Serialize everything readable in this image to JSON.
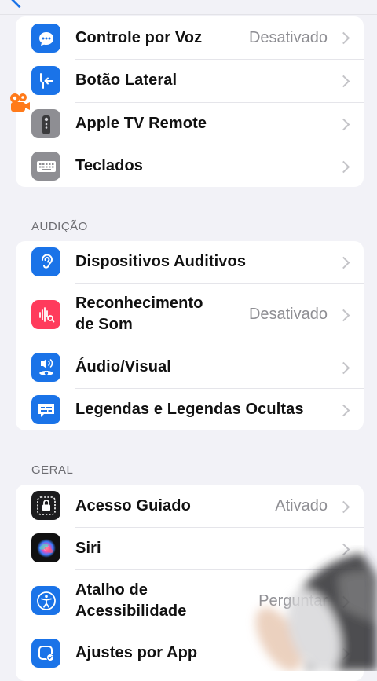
{
  "vision_group": [
    {
      "label": "Controle por Voz",
      "value": "Desativado",
      "icon": "voice-control-icon",
      "color": "#1a73e8"
    },
    {
      "label": "Botão Lateral",
      "value": "",
      "icon": "side-button-icon",
      "color": "#1a73e8"
    },
    {
      "label": "Apple TV Remote",
      "value": "",
      "icon": "tv-remote-icon",
      "color": "#8e8e93"
    },
    {
      "label": "Teclados",
      "value": "",
      "icon": "keyboard-icon",
      "color": "#8e8e93"
    }
  ],
  "hearing": {
    "header": "AUDIÇÃO",
    "items": [
      {
        "label": "Dispositivos Auditivos",
        "value": "",
        "icon": "ear-icon",
        "color": "#1a73e8"
      },
      {
        "label_line1": "Reconhecimento",
        "label_line2": "de Som",
        "value": "Desativado",
        "icon": "sound-recognition-icon",
        "color": "#ff3b5c"
      },
      {
        "label": "Áudio/Visual",
        "value": "",
        "icon": "speaker-eye-icon",
        "color": "#1a73e8"
      },
      {
        "label": "Legendas e Legendas Ocultas",
        "value": "",
        "icon": "captions-icon",
        "color": "#1a73e8"
      }
    ]
  },
  "general": {
    "header": "GERAL",
    "items": [
      {
        "label": "Acesso Guiado",
        "value": "Ativado",
        "icon": "guided-access-icon",
        "color": "#1c1c1e"
      },
      {
        "label": "Siri",
        "value": "",
        "icon": "siri-icon",
        "color": "#111111"
      },
      {
        "label_line1": "Atalho de",
        "label_line2": "Acessibilidade",
        "value": "Perguntar",
        "icon": "accessibility-icon",
        "color": "#1a73e8"
      },
      {
        "label": "Ajustes por App",
        "value": "",
        "icon": "per-app-settings-icon",
        "color": "#1a73e8"
      }
    ]
  },
  "colors": {
    "background": "#f2f2f7",
    "accent": "#1a73e8",
    "secondary_text": "#8e8e93"
  },
  "overlay": {
    "logo_icon": "video-app-watermark-icon"
  }
}
